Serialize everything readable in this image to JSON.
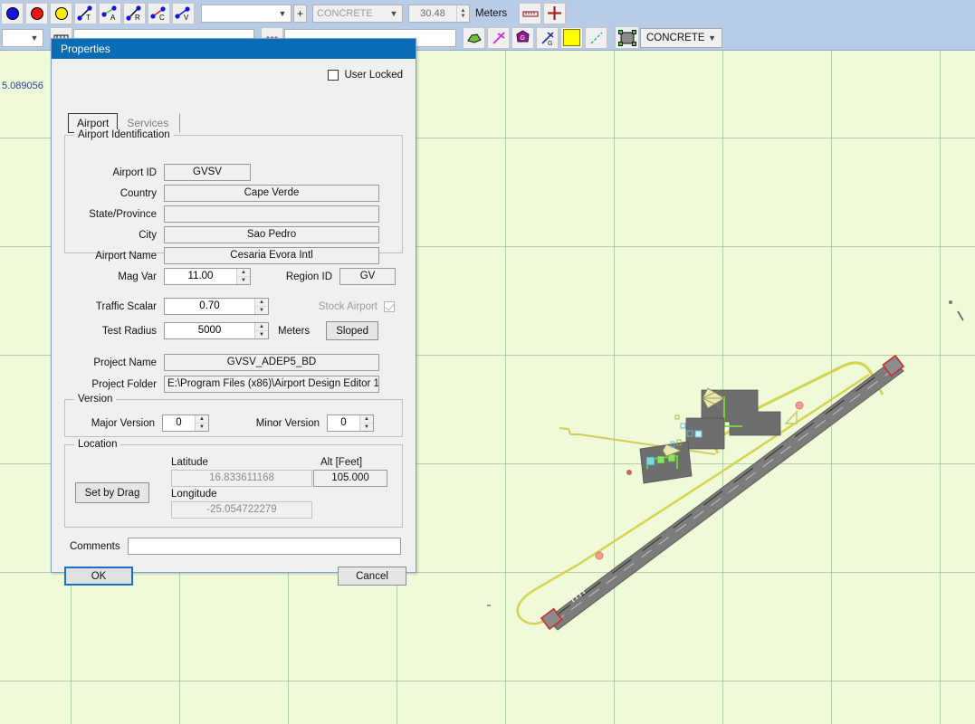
{
  "app": {
    "map_coordinate_label": "5.089056"
  },
  "toolbar": {
    "row1": {
      "icon_buttons": [
        {
          "name": "blue-circle-tool",
          "label": ""
        },
        {
          "name": "red-circle-tool",
          "label": ""
        },
        {
          "name": "yellow-circle-tool",
          "label": ""
        },
        {
          "name": "taxiway-line-tool",
          "label": "T"
        },
        {
          "name": "apron-line-tool",
          "label": "A"
        },
        {
          "name": "runway-line-tool",
          "label": "R"
        },
        {
          "name": "centerline-tool",
          "label": "C"
        },
        {
          "name": "vector-line-tool",
          "label": "V"
        }
      ],
      "type_combo_value": "",
      "add_button_label": "+",
      "surface_combo_value": "CONCRETE",
      "width_value": "30.48",
      "units_label": "Meters",
      "ruler_icon": "ruler-icon",
      "crosshair_icon": "plus-icon"
    },
    "row2": {
      "left_combo_value": "",
      "mid_combo_value": "",
      "icon_buttons": [
        {
          "name": "polygon-green-tool"
        },
        {
          "name": "magenta-cross-tool"
        },
        {
          "name": "gate-purple-tool"
        },
        {
          "name": "glideslope-tool"
        },
        {
          "name": "yellow-fill-tool"
        },
        {
          "name": "dashed-line-tool"
        },
        {
          "name": "selection-box-tool"
        }
      ],
      "surface_combo_value": "CONCRETE"
    }
  },
  "dialog": {
    "title": "Properties",
    "user_locked_label": "User Locked",
    "user_locked_checked": false,
    "tabs": [
      {
        "label": "Airport",
        "active": true
      },
      {
        "label": "Services",
        "active": false
      }
    ],
    "airport_identification": {
      "legend": "Airport Identification",
      "fields": [
        {
          "label": "Airport ID",
          "value": "GVSV"
        },
        {
          "label": "Country",
          "value": "Cape Verde"
        },
        {
          "label": "State/Province",
          "value": ""
        },
        {
          "label": "City",
          "value": "Sao Pedro"
        },
        {
          "label": "Airport Name",
          "value": "Cesaria Evora Intl"
        }
      ],
      "mag_var_label": "Mag Var",
      "mag_var_value": "11.00",
      "region_id_label": "Region ID",
      "region_id_value": "GV"
    },
    "settings": {
      "traffic_scalar_label": "Traffic Scalar",
      "traffic_scalar_value": "0.70",
      "stock_airport_label": "Stock Airport",
      "stock_airport_checked": true,
      "test_radius_label": "Test Radius",
      "test_radius_value": "5000",
      "test_radius_units": "Meters",
      "sloped_button_label": "Sloped",
      "project_name_label": "Project Name",
      "project_name_value": "GVSV_ADEP5_BD",
      "project_folder_label": "Project Folder",
      "project_folder_value": "E:\\Program Files (x86)\\Airport Design Editor 1"
    },
    "version": {
      "legend": "Version",
      "major_label": "Major Version",
      "major_value": "0",
      "minor_label": "Minor Version",
      "minor_value": "0"
    },
    "location": {
      "legend": "Location",
      "set_by_drag_label": "Set by Drag",
      "latitude_label": "Latitude",
      "latitude_value": "16.833611168",
      "longitude_label": "Longitude",
      "longitude_value": "-25.054722279",
      "alt_label": "Alt [Feet]",
      "alt_value": "105.000"
    },
    "comments_label": "Comments",
    "comments_value": "",
    "comments_placeholder": "",
    "ok_label": "OK",
    "cancel_label": "Cancel"
  },
  "colors": {
    "title_bar": "#0a6cb4",
    "toolbar_bg": "#b8cce8",
    "dialog_bg": "#f0f0f0",
    "map_bg": "#eefad8",
    "runway": "#7a7a7a",
    "taxiway_line": "#d8d85a",
    "accent_blue": "#1472c8"
  }
}
